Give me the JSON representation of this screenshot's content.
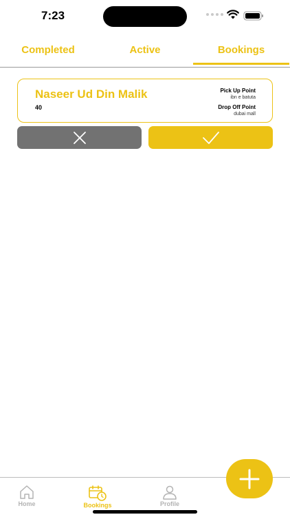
{
  "status_bar": {
    "time": "7:23"
  },
  "tabs": [
    {
      "label": "Completed"
    },
    {
      "label": "Active"
    },
    {
      "label": "Bookings"
    }
  ],
  "selected_tab": "Bookings",
  "booking": {
    "name": "Naseer Ud Din Malik",
    "number": "40",
    "pickup_label": "Pick Up Point",
    "pickup_value": "ibn e batuta",
    "dropoff_label": "Drop Off Point",
    "dropoff_value": "dubai mall"
  },
  "actions": {
    "reject_icon": "close-icon",
    "accept_icon": "check-icon"
  },
  "bottom_nav": [
    {
      "label": "Home",
      "icon": "home-icon"
    },
    {
      "label": "Bookings",
      "icon": "calendar-clock-icon"
    },
    {
      "label": "Profile",
      "icon": "person-icon"
    }
  ],
  "fab_icon": "plus-icon",
  "colors": {
    "accent": "#ecc215",
    "reject": "#727272",
    "inactive": "#b3b3b3"
  }
}
